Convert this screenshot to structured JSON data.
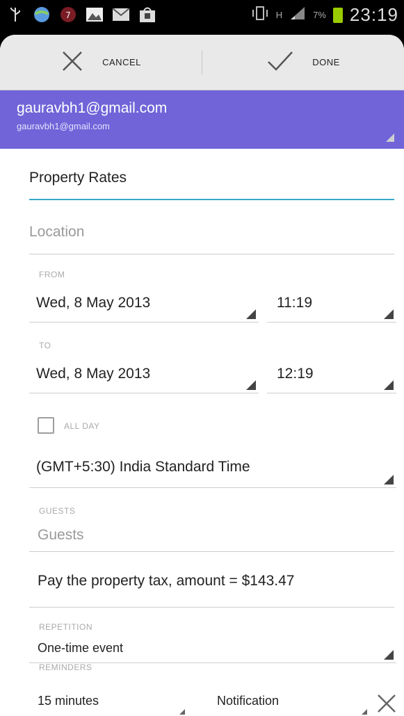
{
  "status_bar": {
    "network_type": "H",
    "battery": "7%",
    "time": "23:19"
  },
  "action_bar": {
    "cancel_label": "CANCEL",
    "done_label": "DONE"
  },
  "account": {
    "name": "gauravbh1@gmail.com",
    "email": "gauravbh1@gmail.com"
  },
  "event": {
    "title": "Property Rates",
    "location_placeholder": "Location",
    "from_label": "FROM",
    "from_date": "Wed, 8 May 2013",
    "from_time": "11:19",
    "to_label": "TO",
    "to_date": "Wed, 8 May 2013",
    "to_time": "12:19",
    "all_day_label": "ALL DAY",
    "timezone": "(GMT+5:30) India Standard Time",
    "guests_label": "GUESTS",
    "guests_placeholder": "Guests",
    "description": "Pay the property tax, amount = $143.47",
    "repetition_label": "REPETITION",
    "repetition_value": "One-time event",
    "reminders_label": "REMINDERS",
    "reminder_time": "15 minutes",
    "reminder_method": "Notification"
  }
}
